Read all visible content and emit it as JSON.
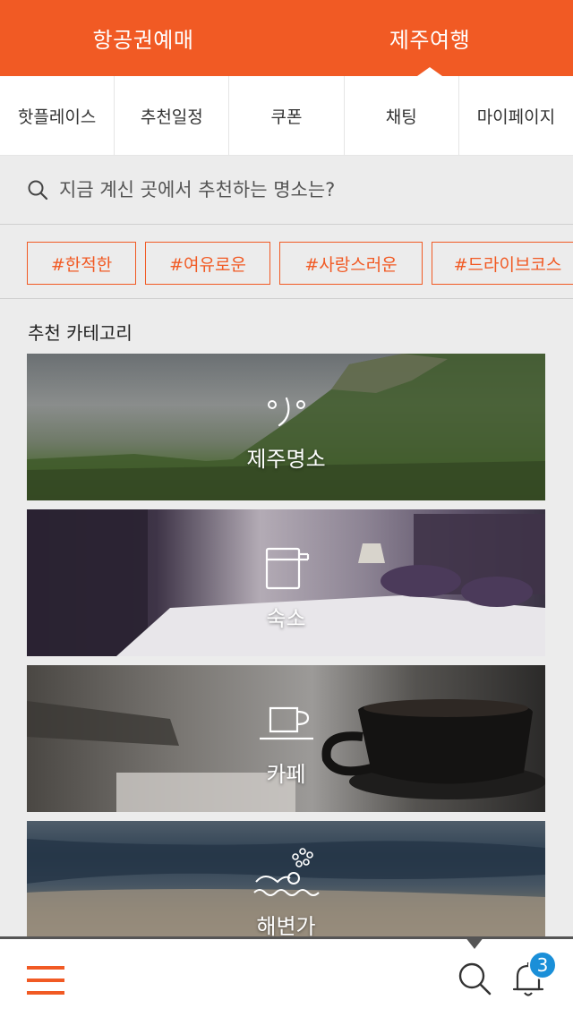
{
  "header": {
    "tabs": [
      {
        "label": "항공권예매"
      },
      {
        "label": "제주여행"
      }
    ]
  },
  "subnav": {
    "items": [
      {
        "label": "핫플레이스"
      },
      {
        "label": "추천일정"
      },
      {
        "label": "쿠폰"
      },
      {
        "label": "채팅"
      },
      {
        "label": "마이페이지"
      }
    ]
  },
  "search": {
    "placeholder": "지금 계신 곳에서 추천하는 명소는?"
  },
  "tags": [
    {
      "label": "#한적한"
    },
    {
      "label": "#여유로운"
    },
    {
      "label": "#사랑스러운"
    },
    {
      "label": "#드라이브코스"
    }
  ],
  "section": {
    "title": "추천 카테고리"
  },
  "categories": [
    {
      "label": "제주명소",
      "icon": "landmark-icon"
    },
    {
      "label": "숙소",
      "icon": "accommodation-icon"
    },
    {
      "label": "카페",
      "icon": "coffee-cup-icon"
    },
    {
      "label": "해변가",
      "icon": "beach-wave-icon"
    }
  ],
  "bottom": {
    "notification_count": "3"
  },
  "colors": {
    "accent": "#f15a24",
    "badge": "#1a8fd8"
  }
}
